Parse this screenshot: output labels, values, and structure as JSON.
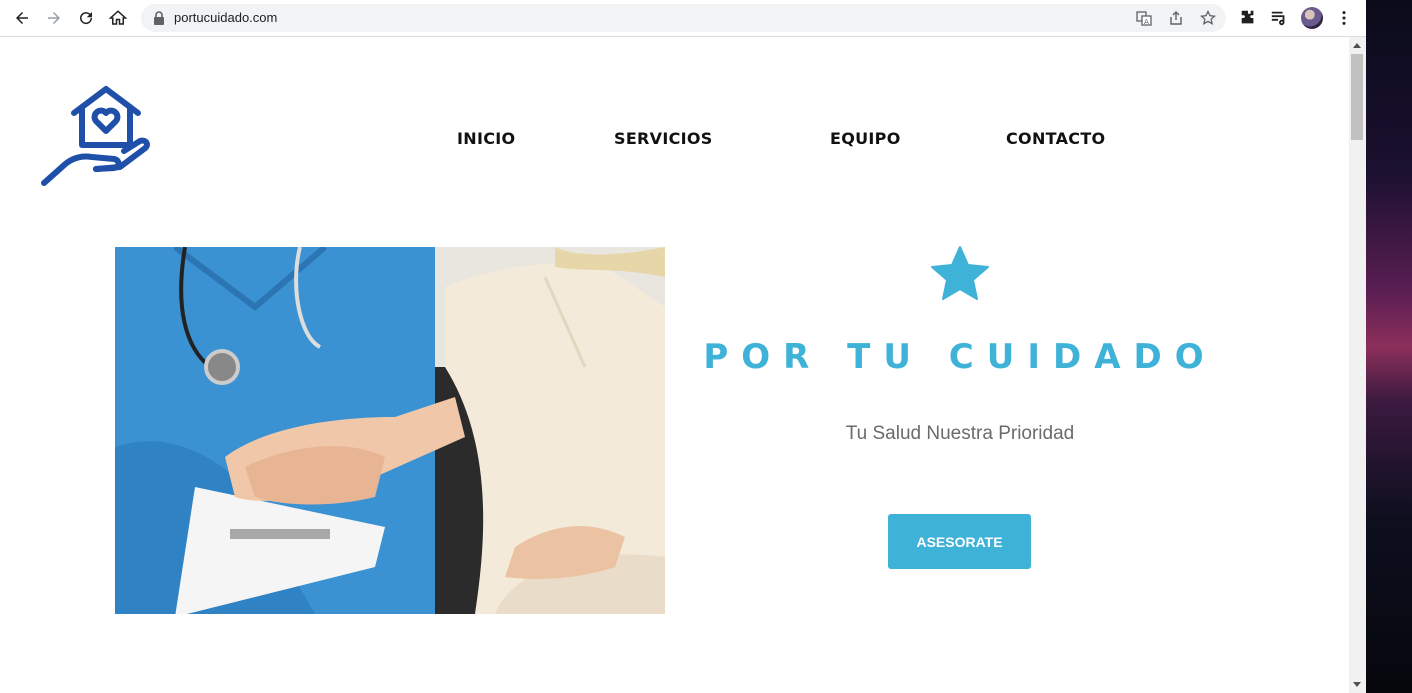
{
  "browser": {
    "url": "portucuidado.com",
    "icons": [
      "back-icon",
      "forward-icon",
      "reload-icon",
      "home-icon",
      "lock-icon",
      "translate-icon",
      "share-icon",
      "star-icon",
      "extensions-icon",
      "reading-list-icon",
      "avatar",
      "menu-dots-icon"
    ]
  },
  "site": {
    "nav": [
      {
        "label": "INICIO"
      },
      {
        "label": "SERVICIOS"
      },
      {
        "label": "EQUIPO"
      },
      {
        "label": "CONTACTO"
      }
    ],
    "hero": {
      "title": "POR TU CUIDADO",
      "subtitle": "Tu Salud Nuestra Prioridad",
      "cta_label": "ASESORATE"
    }
  },
  "colors": {
    "accent": "#3fb2d8",
    "logo": "#1f4fa8",
    "nurse_scrubs": "#3a92d3",
    "text_dark": "#111111",
    "text_muted": "#6b6b6b"
  }
}
